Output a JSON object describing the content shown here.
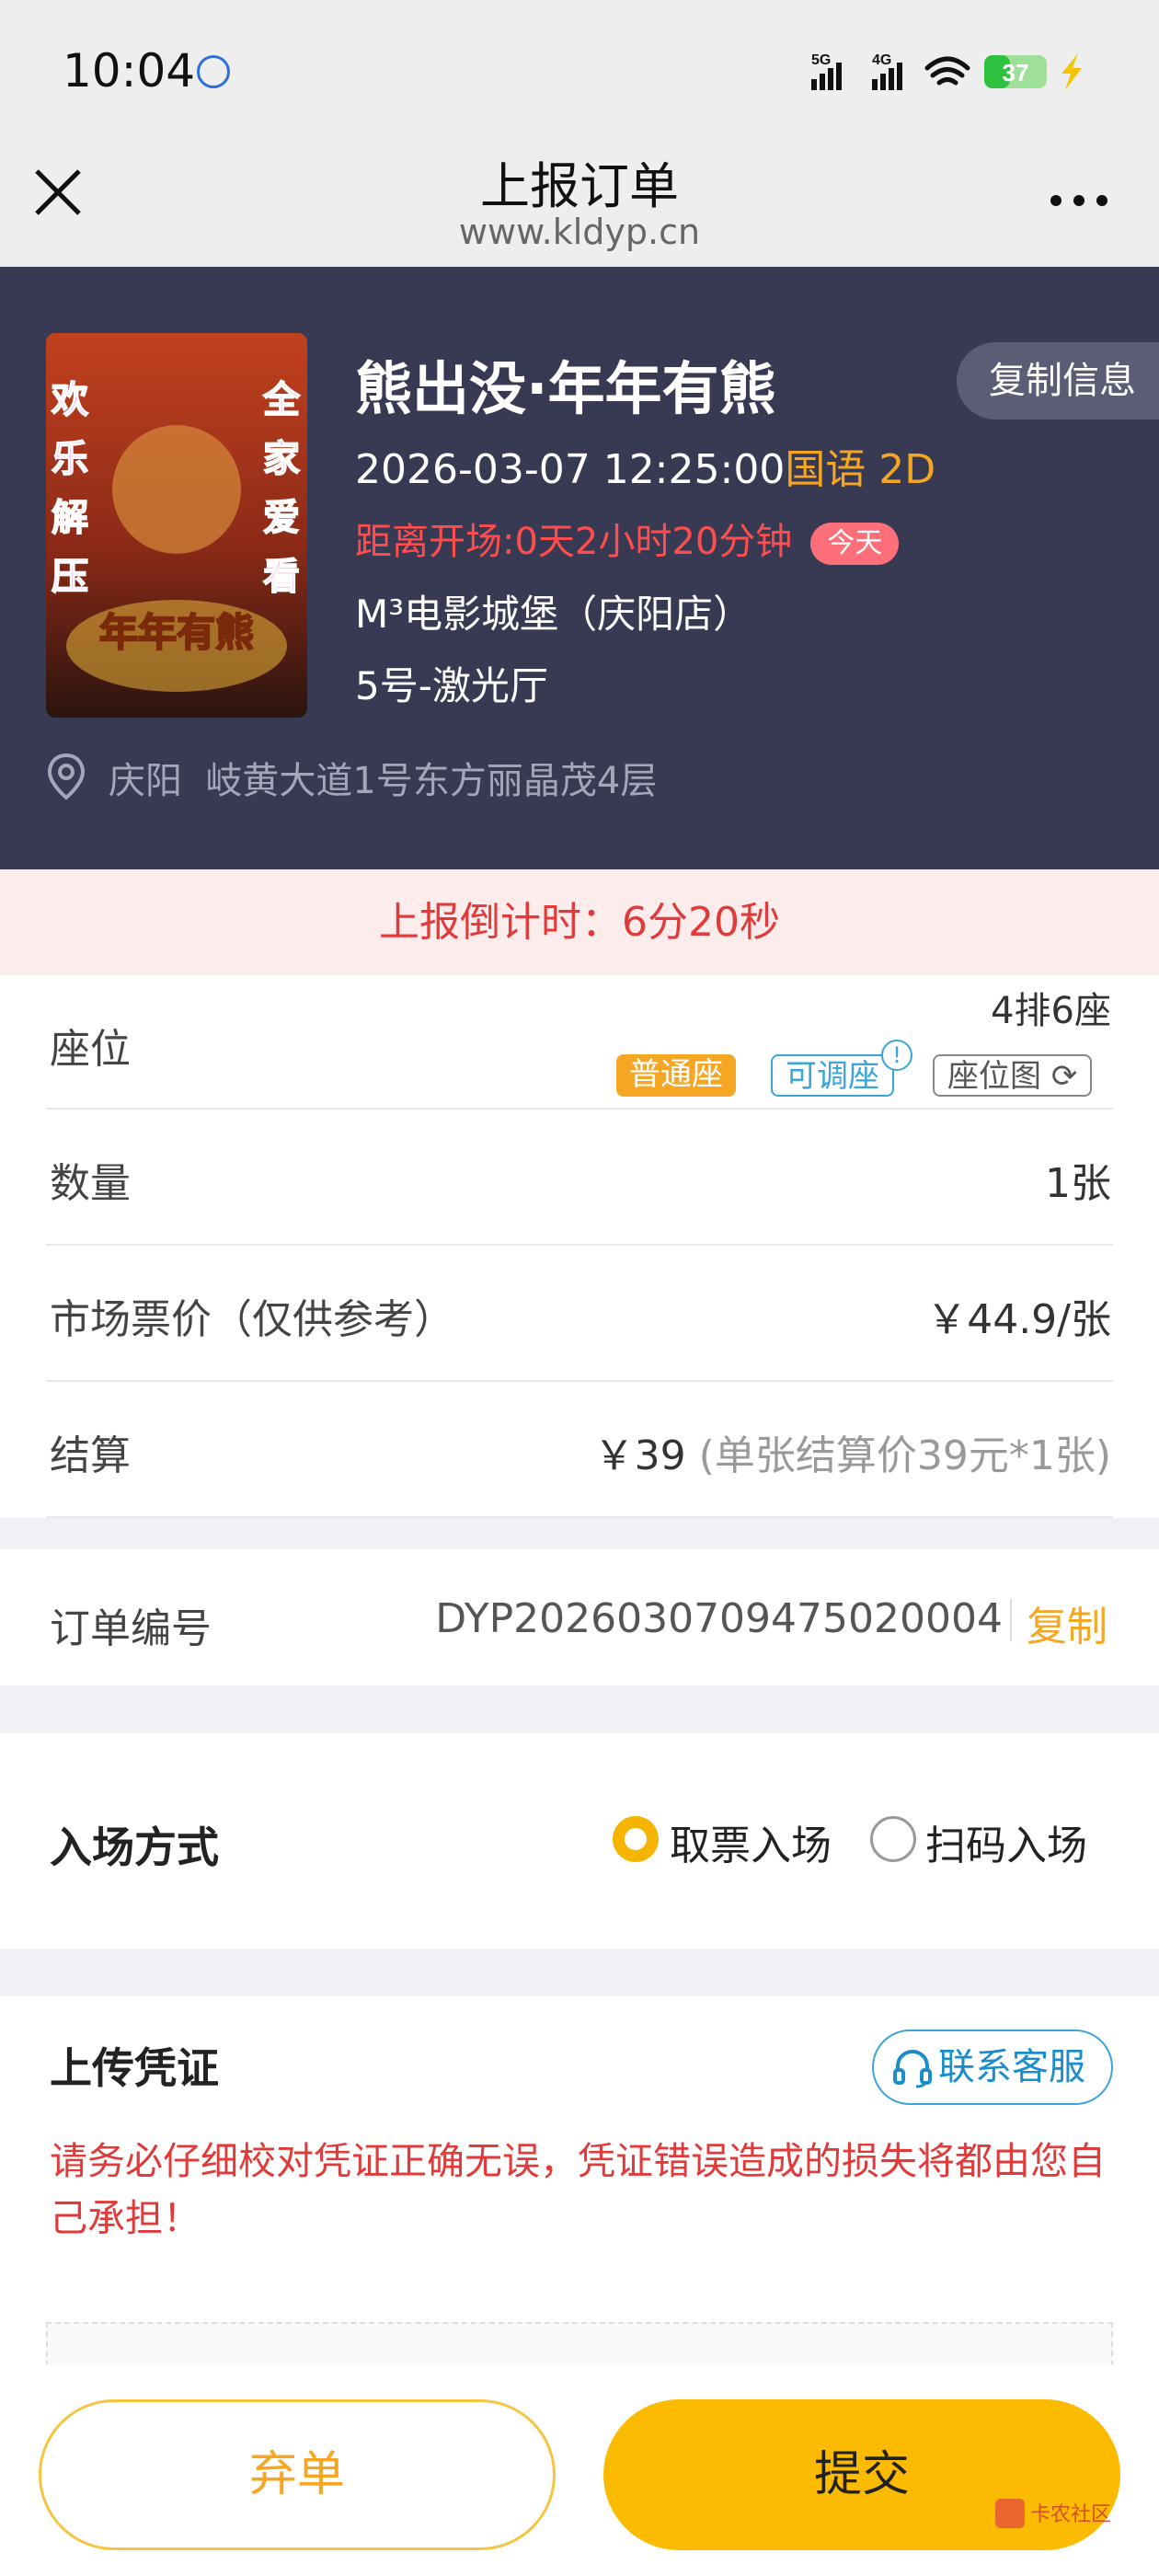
{
  "status_bar": {
    "time": "10:04",
    "net1": "5G",
    "net2": "4G",
    "battery": "37"
  },
  "nav": {
    "title": "上报订单",
    "url": "www.kldyp.cn"
  },
  "movie": {
    "title": "熊出没·年年有熊",
    "copy_info_label": "复制信息",
    "datetime": "2026-03-07 12:25:00",
    "language_format": "国语 2D",
    "countdown": "距离开场:0天2小时20分钟",
    "today_badge": "今天",
    "cinema": "M³电影城堡（庆阳店）",
    "hall": "5号-激光厅",
    "city": "庆阳",
    "address": "岐黄大道1号东方丽晶茂4层",
    "poster_texts": {
      "left": "欢乐解压",
      "right": "全家爱看",
      "logo": "年年有熊"
    }
  },
  "report_countdown": "上报倒计时：6分20秒",
  "details": {
    "seat": {
      "label": "座位",
      "value": "4排6座",
      "tags": [
        "普通座",
        "可调座",
        "座位图"
      ],
      "info_mark": "!"
    },
    "quantity": {
      "label": "数量",
      "value": "1张"
    },
    "market_price": {
      "label": "市场票价（仅供参考）",
      "value": "￥44.9/张"
    },
    "settlement": {
      "label": "结算",
      "value": "￥39",
      "note": "(单张结算价39元*1张)"
    }
  },
  "order": {
    "label": "订单编号",
    "number": "DYP2026030709475020004",
    "copy_label": "复制"
  },
  "entry": {
    "label": "入场方式",
    "options": [
      "取票入场",
      "扫码入场"
    ],
    "selected": "取票入场"
  },
  "upload": {
    "title": "上传凭证",
    "service_label": "联系客服",
    "warning": "请务必仔细校对凭证正确无误，凭证错误造成的损失将都由您自己承担！"
  },
  "actions": {
    "abandon": "弃单",
    "submit": "提交"
  },
  "watermark": "卡农社区",
  "colors": {
    "accent": "#fcbb00",
    "header_bg": "#383a54",
    "alert_red": "#e03a3a",
    "link_blue": "#3ba4d8"
  }
}
